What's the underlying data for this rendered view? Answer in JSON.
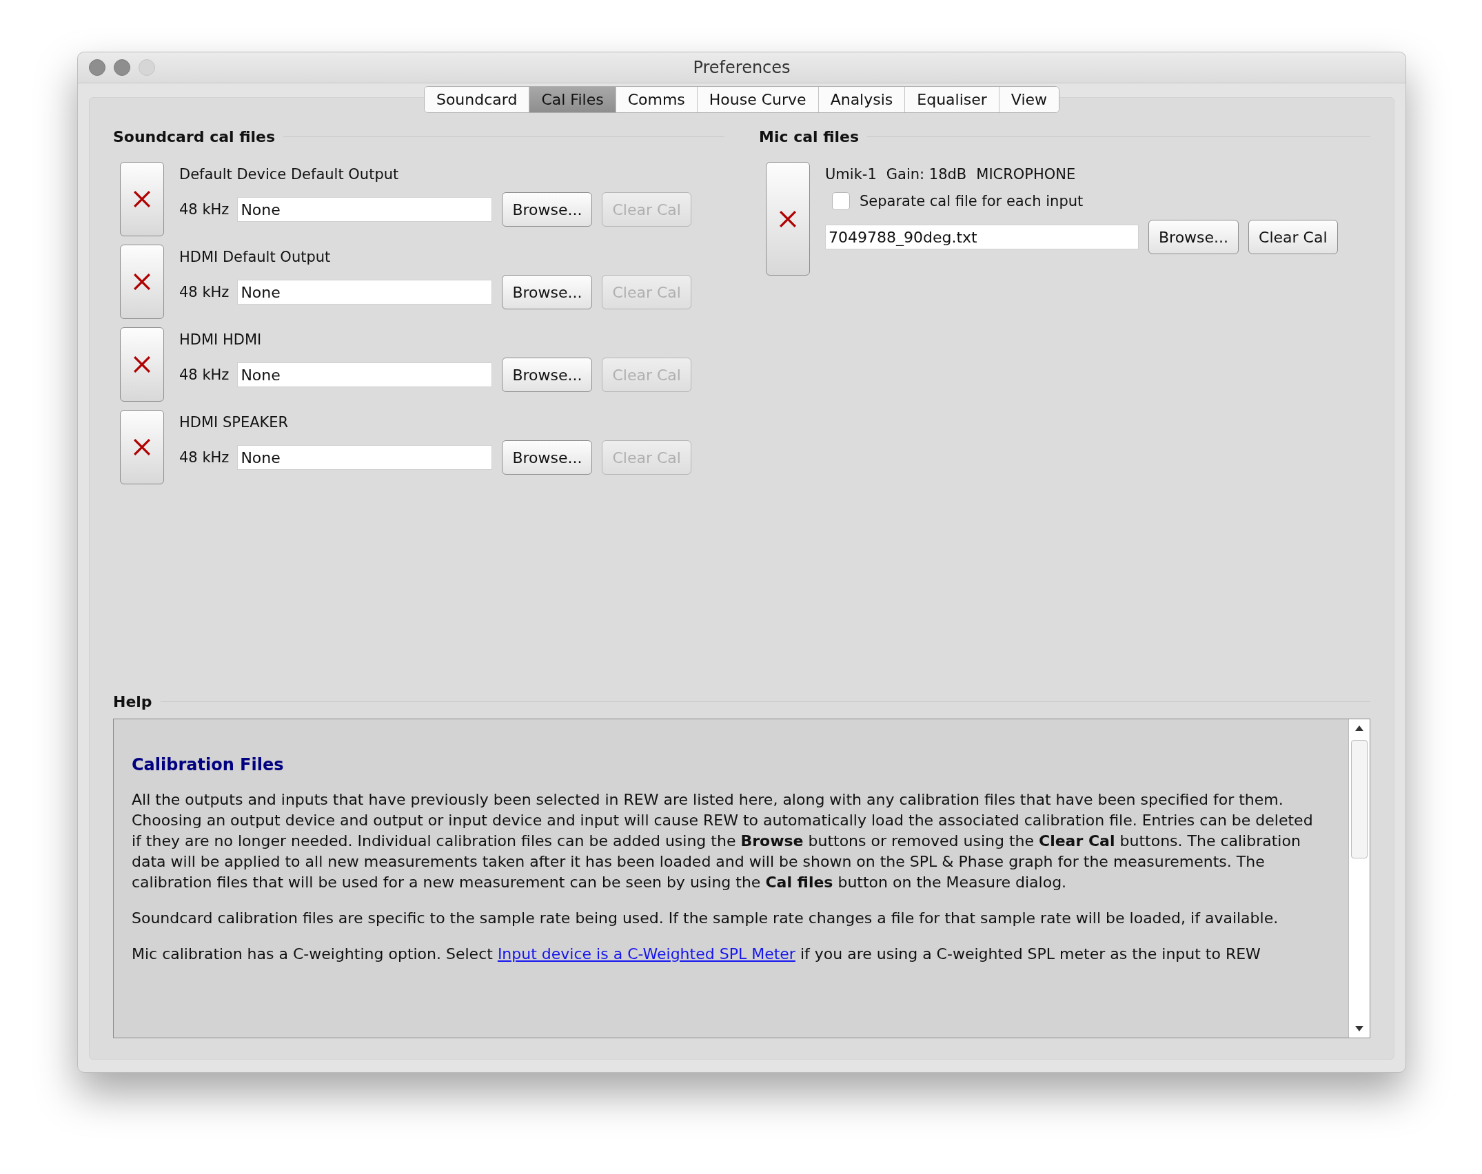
{
  "window": {
    "title": "Preferences"
  },
  "tabs": [
    {
      "label": "Soundcard",
      "selected": false
    },
    {
      "label": "Cal Files",
      "selected": true
    },
    {
      "label": "Comms",
      "selected": false
    },
    {
      "label": "House Curve",
      "selected": false
    },
    {
      "label": "Analysis",
      "selected": false
    },
    {
      "label": "Equaliser",
      "selected": false
    },
    {
      "label": "View",
      "selected": false
    }
  ],
  "soundcard_cal_files": {
    "title": "Soundcard cal files",
    "entries": [
      {
        "device": "Default Device Default Output",
        "rate": "48 kHz",
        "file": "None",
        "browse": "Browse...",
        "clear": "Clear Cal",
        "clear_disabled": true
      },
      {
        "device": "HDMI Default Output",
        "rate": "48 kHz",
        "file": "None",
        "browse": "Browse...",
        "clear": "Clear Cal",
        "clear_disabled": true
      },
      {
        "device": "HDMI HDMI",
        "rate": "48 kHz",
        "file": "None",
        "browse": "Browse...",
        "clear": "Clear Cal",
        "clear_disabled": true
      },
      {
        "device": "HDMI SPEAKER",
        "rate": "48 kHz",
        "file": "None",
        "browse": "Browse...",
        "clear": "Clear Cal",
        "clear_disabled": true
      }
    ]
  },
  "mic_cal_files": {
    "title": "Mic cal files",
    "device": "Umik-1",
    "gain": "Gain: 18dB",
    "type": "MICROPHONE",
    "separate_input": {
      "label": "Separate cal file for each input",
      "checked": false
    },
    "file": "7049788_90deg.txt",
    "browse": "Browse...",
    "clear": "Clear Cal",
    "clear_disabled": false
  },
  "help": {
    "title": "Help",
    "heading": "Calibration Files",
    "paragraphs": [
      [
        {
          "kind": "text",
          "text": "All the outputs and inputs that have previously been selected in REW are listed here, along with any calibration files that have been specified for them. Choosing an output device and output or input device and input will cause REW to automatically load the associated calibration file. Entries can be deleted if they are no longer needed. Individual calibration files can be added using the **Browse** buttons or removed using the **Clear Cal** buttons. The calibration data will be applied to all new measurements taken after it has been loaded and will be shown on the SPL & Phase graph for the measurements. The calibration files that will be used for a new measurement can be seen by using the **Cal files** button on the Measure dialog."
        }
      ],
      [
        {
          "kind": "text",
          "text": "Soundcard calibration files are specific to the sample rate being used. If the sample rate changes a file for that sample rate will be loaded, if available."
        }
      ],
      [
        {
          "kind": "text",
          "text": "Mic calibration has a C-weighting option. Select "
        },
        {
          "kind": "link",
          "text": "Input device is a C-Weighted SPL Meter"
        },
        {
          "kind": "text",
          "text": " if you are using a C-weighted SPL meter as the input to REW"
        }
      ]
    ]
  }
}
